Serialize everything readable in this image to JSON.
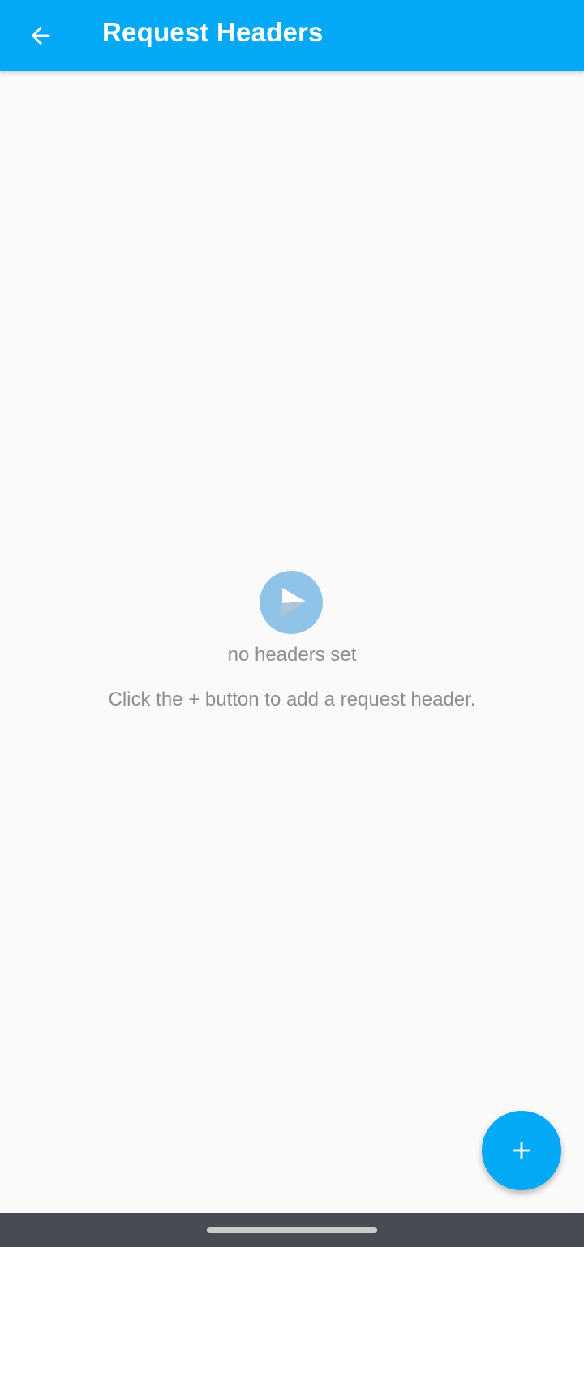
{
  "app_bar": {
    "title": "Request Headers",
    "back_icon": "arrow-left-icon",
    "color": "#03a9f4"
  },
  "empty_state": {
    "icon": "paper-plane-icon",
    "title": "no headers set",
    "hint": "Click the + button to add a request header."
  },
  "fab": {
    "icon": "plus-icon",
    "color": "#03a9f4"
  },
  "system_nav": {
    "color": "#464c51"
  }
}
